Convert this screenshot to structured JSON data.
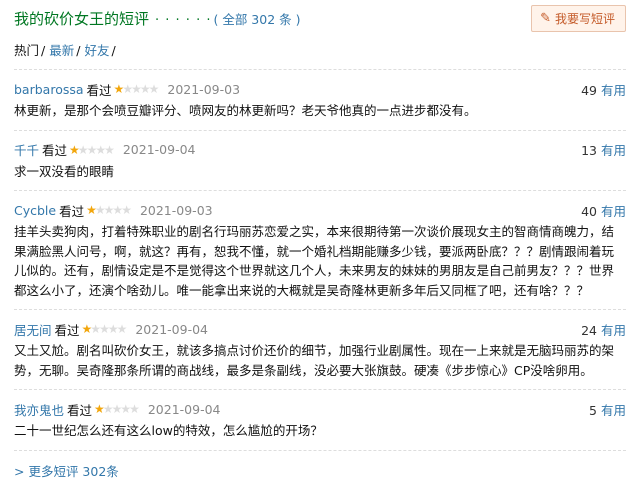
{
  "header": {
    "title": "我的砍价女王的短评",
    "dots": "· · · · · ·",
    "total": "( 全部 302 条 )",
    "write_button": "我要写短评",
    "write_icon": "pencil-icon"
  },
  "tabs": [
    {
      "label": "热门",
      "active": true
    },
    {
      "label": "最新",
      "active": false
    },
    {
      "label": "好友",
      "active": false
    }
  ],
  "tab_separator": "/",
  "reviews": [
    {
      "user": "barbarossa",
      "watched": "看过",
      "stars": 1,
      "max_stars": 5,
      "date": "2021-09-03",
      "votes": "49",
      "useful": "有用",
      "text": "林更新，是那个会喷豆瓣评分、喷网友的林更新吗？老天爷他真的一点进步都没有。"
    },
    {
      "user": "千千",
      "watched": "看过",
      "stars": 1,
      "max_stars": 5,
      "date": "2021-09-04",
      "votes": "13",
      "useful": "有用",
      "text": "求一双没看的眼睛"
    },
    {
      "user": "Cycble",
      "watched": "看过",
      "stars": 1,
      "max_stars": 5,
      "date": "2021-09-03",
      "votes": "40",
      "useful": "有用",
      "text": "挂羊头卖狗肉，打着特殊职业的剧名行玛丽苏恋爱之实，本来很期待第一次谈价展现女主的智商情商魄力，结果满脸黑人问号，啊，就这？再有，恕我不懂，就一个婚礼档期能赚多少钱，要派两卧底？？？剧情跟闹着玩儿似的。还有，剧情设定是不是觉得这个世界就这几个人，未来男友的妹妹的男朋友是自己前男友？？？世界都这么小了，还演个啥劲儿。唯一能拿出来说的大概就是吴奇隆林更新多年后又同框了吧，还有啥？？？"
    },
    {
      "user": "居无间",
      "watched": "看过",
      "stars": 1,
      "max_stars": 5,
      "date": "2021-09-04",
      "votes": "24",
      "useful": "有用",
      "text": "又土又尬。剧名叫砍价女王，就该多搞点讨价还价的细节，加强行业剧属性。现在一上来就是无脑玛丽苏的架势，无聊。吴奇隆那条所谓的商战线，最多是条副线，没必要大张旗鼓。硬凑《步步惊心》CP没啥卵用。"
    },
    {
      "user": "我亦鬼也",
      "watched": "看过",
      "stars": 1,
      "max_stars": 5,
      "date": "2021-09-04",
      "votes": "5",
      "useful": "有用",
      "text": "二十一世纪怎么还有这么low的特效，怎么尴尬的开场？"
    }
  ],
  "more_link": "> 更多短评 302条",
  "colors": {
    "title_green": "#007722",
    "link_blue": "#3377aa",
    "star_orange": "#f2a60c",
    "button_bg": "#fff3ea"
  }
}
